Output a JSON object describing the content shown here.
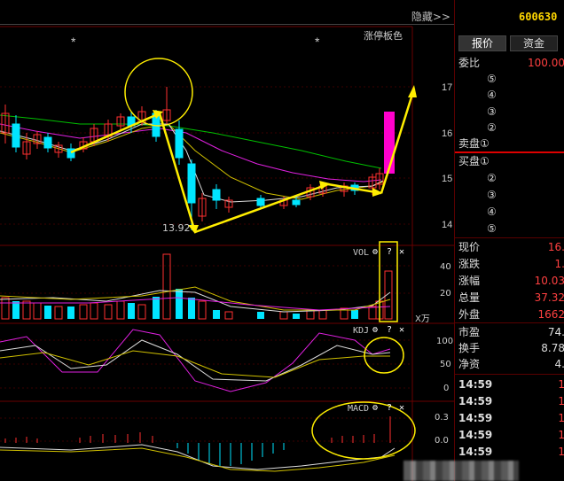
{
  "header": {
    "hide_label": "隐藏>>",
    "stock_code": "600630"
  },
  "main_chart": {
    "limit_color_label": "涨停板色",
    "low_label": "13.92",
    "price_axis": [
      "17",
      "16",
      "15",
      "14"
    ],
    "star_marks": [
      "*",
      "*"
    ]
  },
  "vol_panel": {
    "name": "VOL",
    "axis": [
      "40",
      "20"
    ],
    "unit": "X万",
    "gear_icon": "gear-icon",
    "help_icon": "question-icon",
    "close_icon": "close-icon"
  },
  "kdj_panel": {
    "name": "KDJ",
    "axis": [
      "100",
      "50",
      "0"
    ]
  },
  "macd_panel": {
    "name": "MACD",
    "axis": [
      "0.3",
      "0.0"
    ]
  },
  "right_panel": {
    "tabs": [
      "报价",
      "资金"
    ],
    "weibi_label": "委比",
    "weibi_value": "100.00",
    "sell_levels": [
      "⑤",
      "④",
      "③",
      "②"
    ],
    "sell1_label": "卖盘①",
    "buy1_label": "买盘①",
    "buy_levels": [
      "②",
      "③",
      "④",
      "⑤"
    ],
    "stats": [
      {
        "label": "现价",
        "value": "16."
      },
      {
        "label": "涨跌",
        "value": "1."
      },
      {
        "label": "涨幅",
        "value": "10.03"
      },
      {
        "label": "总量",
        "value": "37.32"
      },
      {
        "label": "外盘",
        "value": "1662"
      },
      {
        "label": "市盈",
        "value": "74."
      },
      {
        "label": "换手",
        "value": "8.78"
      },
      {
        "label": "净资",
        "value": "4."
      }
    ],
    "ticks": [
      {
        "time": "14:59",
        "value": "1"
      },
      {
        "time": "14:59",
        "value": "1"
      },
      {
        "time": "14:59",
        "value": "1"
      },
      {
        "time": "14:59",
        "value": "1"
      },
      {
        "time": "14:59",
        "value": "1"
      }
    ]
  },
  "colors": {
    "up": "#ff3030",
    "down": "#00e5ff",
    "annotation": "#ffee00",
    "limit_bar": "#ff00cc"
  }
}
